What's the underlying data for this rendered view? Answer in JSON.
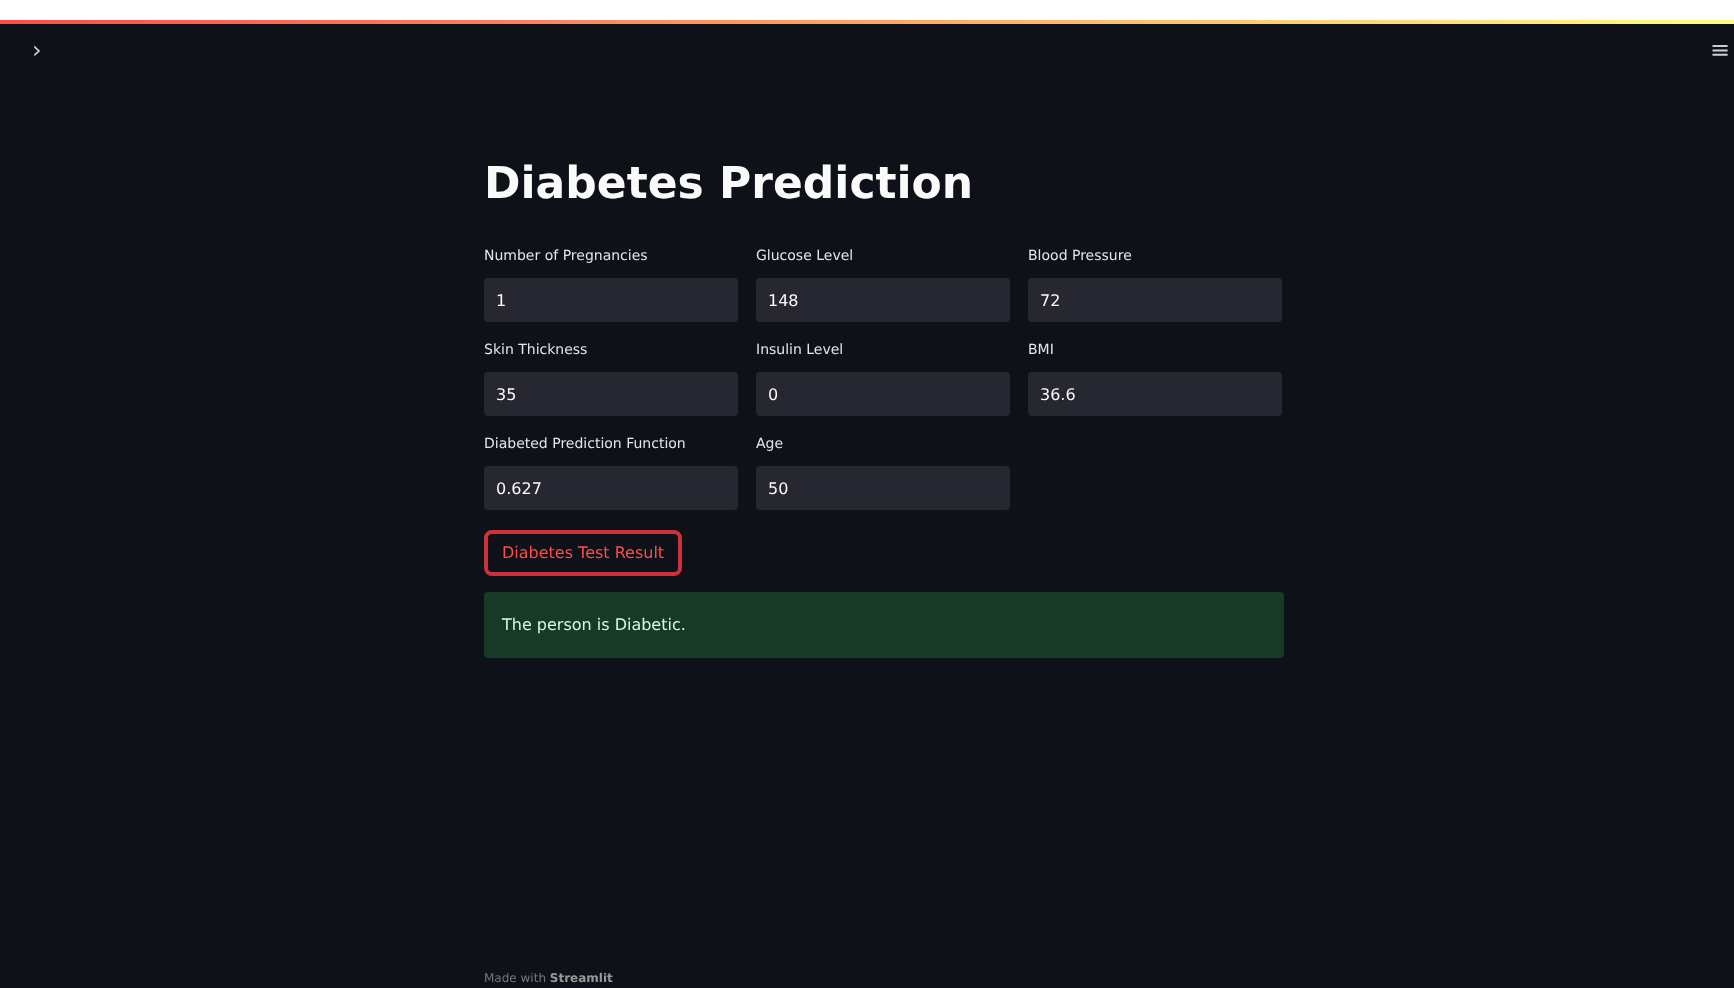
{
  "sidebar_toggle": "›",
  "menu_icon": "≡",
  "title": "Diabetes Prediction",
  "fields": [
    {
      "label": "Number of Pregnancies",
      "value": "1"
    },
    {
      "label": "Glucose Level",
      "value": "148"
    },
    {
      "label": "Blood Pressure",
      "value": "72"
    },
    {
      "label": "Skin Thickness",
      "value": "35"
    },
    {
      "label": "Insulin Level",
      "value": "0"
    },
    {
      "label": "BMI",
      "value": "36.6"
    },
    {
      "label": "Diabeted Prediction Function",
      "value": "0.627"
    },
    {
      "label": "Age",
      "value": "50"
    }
  ],
  "button": "Diabetes Test Result",
  "result": "The person is Diabetic.",
  "footer": {
    "prefix": "Made with",
    "brand": "Streamlit"
  }
}
